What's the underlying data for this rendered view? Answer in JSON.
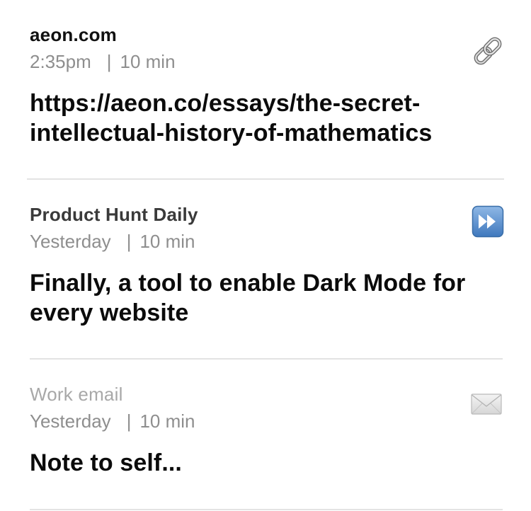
{
  "feed": {
    "items": [
      {
        "source": "aeon.com",
        "time": "2:35pm",
        "separator": "|",
        "duration": "10 min",
        "title": "https://aeon.co/essays/the-secret-intellectual-history-of-mathematics",
        "icon": "link-icon"
      },
      {
        "source": "Product Hunt Daily",
        "time": "Yesterday",
        "separator": "|",
        "duration": "10 min",
        "title": "Finally, a tool to enable Dark Mode for every website",
        "icon": "fast-forward-icon"
      },
      {
        "source": "Work email",
        "time": "Yesterday",
        "separator": "|",
        "duration": "10 min",
        "title": "Note to self...",
        "icon": "envelope-icon"
      }
    ]
  },
  "colors": {
    "divider": "#e3e3e3",
    "meta_text": "#8e8e8e",
    "fast_forward_blue": "#4a86c8"
  }
}
